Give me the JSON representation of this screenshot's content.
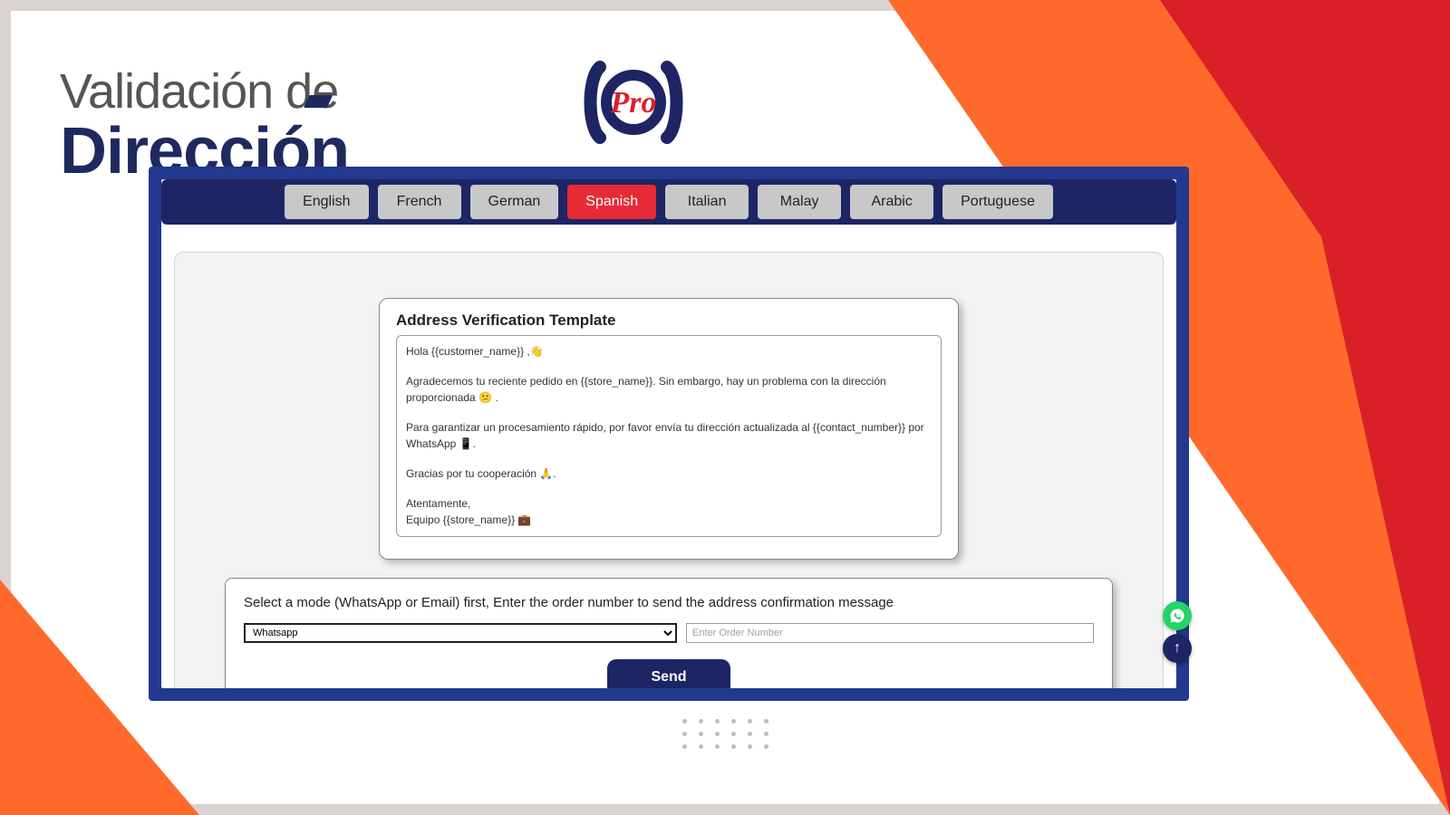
{
  "header": {
    "line1": "Validación de",
    "line2": "Dirección"
  },
  "languages": [
    {
      "key": "english",
      "label": "English",
      "active": false
    },
    {
      "key": "french",
      "label": "French",
      "active": false
    },
    {
      "key": "german",
      "label": "German",
      "active": false
    },
    {
      "key": "spanish",
      "label": "Spanish",
      "active": true
    },
    {
      "key": "italian",
      "label": "Italian",
      "active": false
    },
    {
      "key": "malay",
      "label": "Malay",
      "active": false
    },
    {
      "key": "arabic",
      "label": "Arabic",
      "active": false
    },
    {
      "key": "portuguese",
      "label": "Portuguese",
      "active": false
    }
  ],
  "template": {
    "title": "Address Verification Template",
    "lines": {
      "greeting": "Hola {{customer_name}} ,👋",
      "p1": "Agradecemos tu reciente pedido en {{store_name}}. Sin embargo, hay un problema con la dirección proporcionada 😕 .",
      "p2": "Para garantizar un procesamiento rápido, por favor envía tu dirección actualizada al {{contact_number}} por WhatsApp 📱.",
      "thanks": "Gracias por tu cooperación 🙏.",
      "sign1": "Atentamente,",
      "sign2": "Equipo {{store_name}} 💼"
    }
  },
  "action": {
    "help": "Select a mode (WhatsApp or Email) first, Enter the order number to send the address confirmation message",
    "mode_value": "Whatsapp",
    "order_placeholder": "Enter Order Number",
    "send_label": "Send"
  }
}
